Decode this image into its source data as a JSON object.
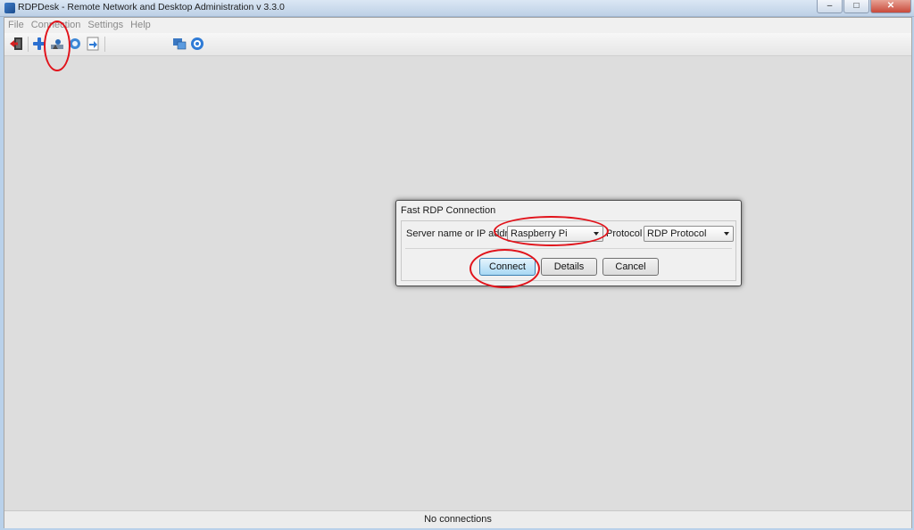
{
  "window": {
    "title": "RDPDesk - Remote Network and Desktop Administration v 3.3.0",
    "minimize": "–",
    "maximize": "□",
    "close": "✕"
  },
  "menu": [
    "File",
    "Connection",
    "Settings",
    "Help"
  ],
  "toolbar": {
    "icons": [
      "exit-icon",
      "add-icon",
      "fast-connect-icon",
      "refresh-icon",
      "import-icon",
      "network-icon",
      "settings-icon"
    ]
  },
  "dialog": {
    "title": "Fast RDP Connection",
    "server_label": "Server name or IP address",
    "server_value": "Raspberry Pi",
    "protocol_label": "Protocol",
    "protocol_value": "RDP Protocol",
    "connect": "Connect",
    "details": "Details",
    "cancel": "Cancel"
  },
  "status": "No connections",
  "colors": {
    "annotation": "#e1131b",
    "default_button": "#a8d8f4"
  }
}
